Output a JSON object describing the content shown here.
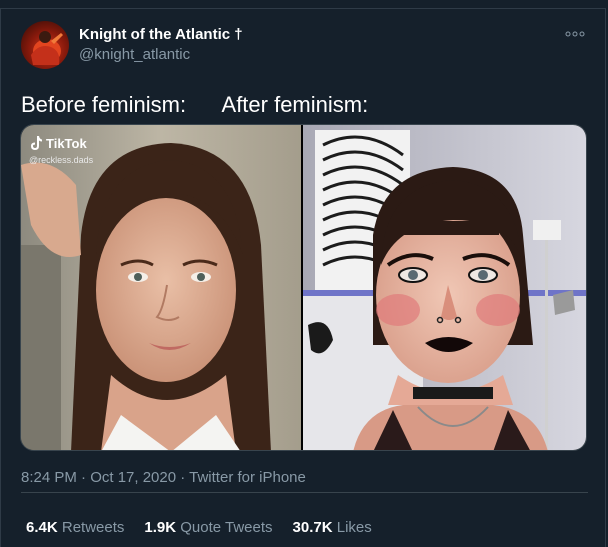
{
  "author": {
    "name": "Knight of the Atlantic †",
    "handle": "@knight_atlantic"
  },
  "tweet": {
    "text": "Before feminism:      After feminism:",
    "timestamp": "8:24 PM · Oct 17, 2020 · Twitter for iPhone"
  },
  "media": {
    "watermark_brand": "TikTok",
    "watermark_user": "@reckless.dads"
  },
  "stats": [
    {
      "value": "6.4K",
      "label": "Retweets"
    },
    {
      "value": "1.9K",
      "label": "Quote Tweets"
    },
    {
      "value": "30.7K",
      "label": "Likes"
    }
  ],
  "icons": {
    "more": "more-options-icon",
    "tiktok": "tiktok-logo-icon"
  },
  "colors": {
    "background": "#15202b",
    "secondary_text": "#8899a6",
    "border": "#38444d"
  }
}
